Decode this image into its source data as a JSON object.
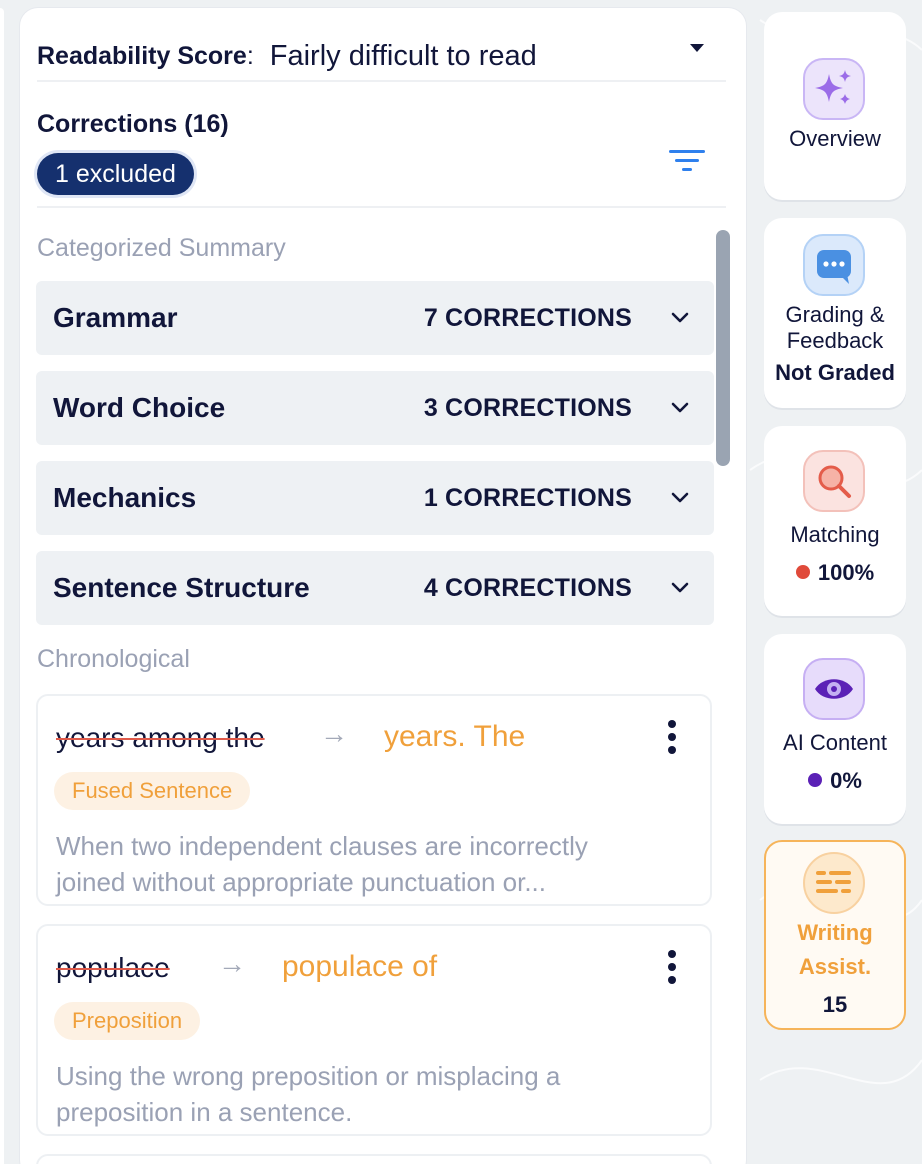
{
  "readability": {
    "label": "Readability Score",
    "colon": ":",
    "value": "Fairly difficult to read"
  },
  "corrections": {
    "title": "Corrections (16)",
    "excluded": "1 excluded"
  },
  "summary": {
    "label": "Categorized Summary",
    "categories": [
      {
        "name": "Grammar",
        "count": "7 CORRECTIONS"
      },
      {
        "name": "Word Choice",
        "count": "3 CORRECTIONS"
      },
      {
        "name": "Mechanics",
        "count": "1 CORRECTIONS"
      },
      {
        "name": "Sentence Structure",
        "count": "4 CORRECTIONS"
      }
    ]
  },
  "chronological": {
    "label": "Chronological",
    "items": [
      {
        "original": "years among the",
        "arrow": "→",
        "suggestion": "years. The",
        "tag": "Fused Sentence",
        "description": "When two independent clauses are incorrectly joined without appropriate punctuation or..."
      },
      {
        "original": "populace",
        "arrow": "→",
        "suggestion": "populace of",
        "tag": "Preposition",
        "description": "Using the wrong preposition or misplacing a preposition in a sentence."
      }
    ]
  },
  "rail": {
    "overview": {
      "label": "Overview",
      "icon": "sparkle-icon"
    },
    "grading": {
      "label_line1": "Grading &",
      "label_line2": "Feedback",
      "status": "Not Graded",
      "icon": "chat-bubble-icon"
    },
    "matching": {
      "label": "Matching",
      "value": "100%",
      "icon": "magnifier-icon",
      "dot_color": "#e04a3a"
    },
    "ai_content": {
      "label": "AI Content",
      "value": "0%",
      "icon": "eye-icon",
      "dot_color": "#5b21b6"
    },
    "writing": {
      "label_line1": "Writing",
      "label_line2": "Assist.",
      "count": "15",
      "icon": "text-lines-icon"
    }
  },
  "colors": {
    "accent_orange": "#f0a03b",
    "pill_navy": "#15306e",
    "strike_red": "#e05a4a",
    "filter_blue": "#2f80ed"
  }
}
